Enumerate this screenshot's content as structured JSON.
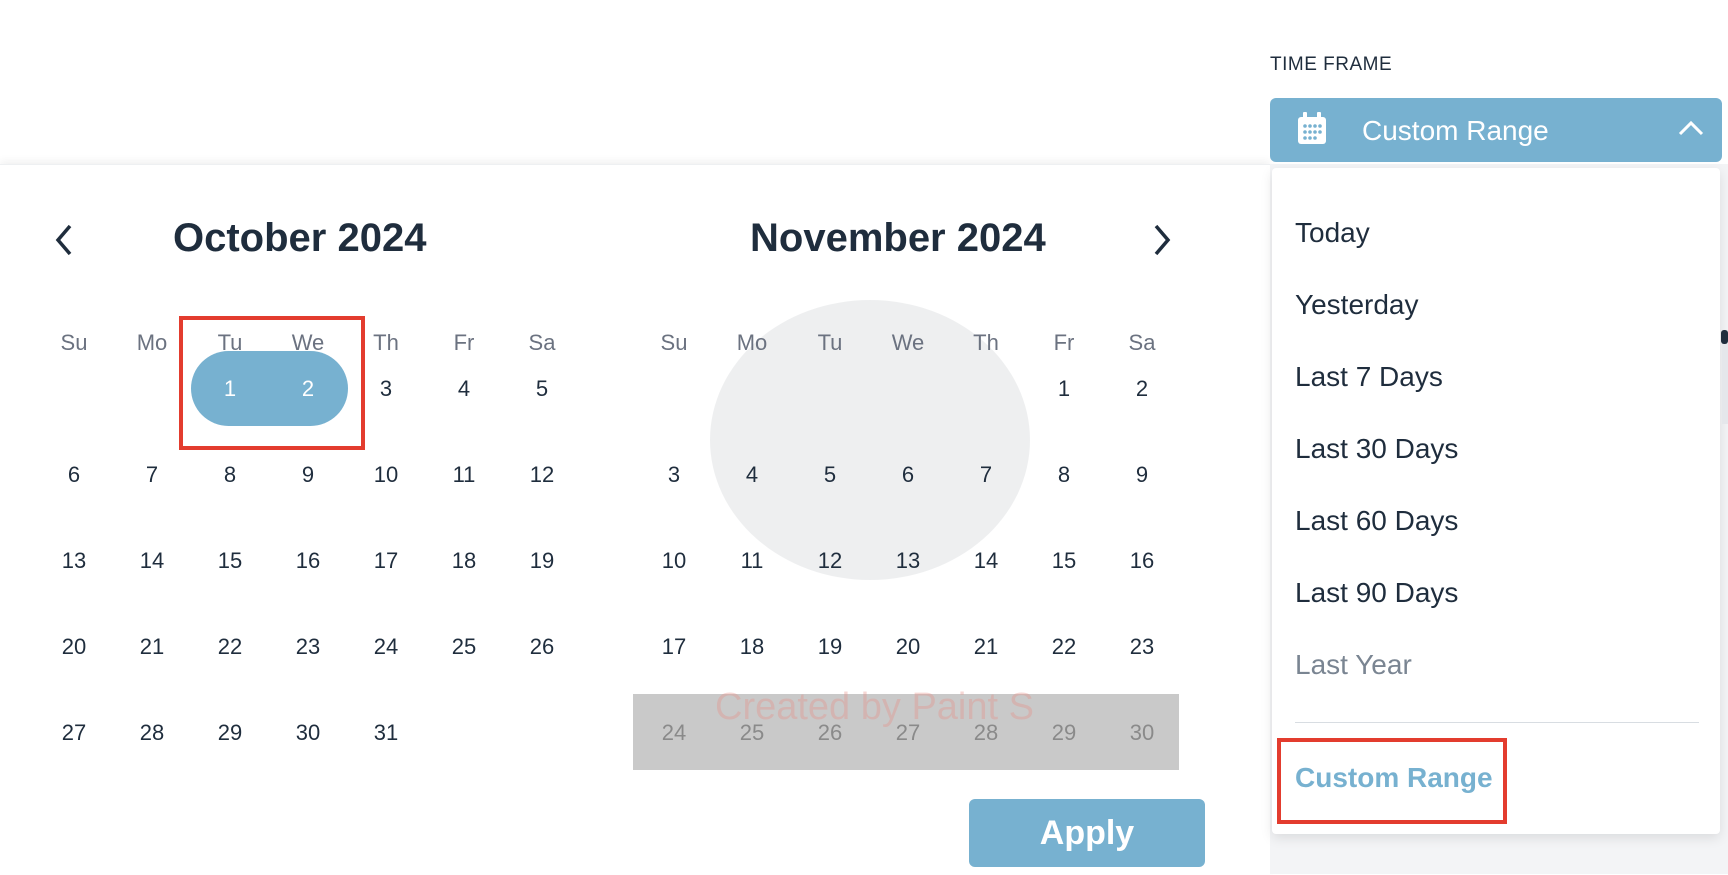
{
  "time_frame": {
    "label": "TIME FRAME",
    "value": "Custom Range"
  },
  "dropdown": {
    "options": [
      "Today",
      "Yesterday",
      "Last 7 Days",
      "Last 30 Days",
      "Last 60 Days",
      "Last 90 Days",
      "Last Year"
    ],
    "custom_range": "Custom Range"
  },
  "calendar": {
    "weekdays": [
      "Su",
      "Mo",
      "Tu",
      "We",
      "Th",
      "Fr",
      "Sa"
    ],
    "months": [
      {
        "title": "October 2024",
        "first_weekday": 2,
        "days": 31,
        "selected": [
          1,
          2
        ]
      },
      {
        "title": "November 2024",
        "first_weekday": 5,
        "days": 30,
        "disabled": [
          24,
          25,
          26,
          27,
          28,
          29,
          30
        ]
      }
    ],
    "apply_label": "Apply"
  },
  "watermark": "Created by Paint S",
  "colors": {
    "accent": "#77b1d0",
    "highlight_box": "#e33c2e",
    "text": "#1f2d3d",
    "disabled_row": "#c9c9c9"
  },
  "icons": {
    "calendar": "calendar-icon",
    "collapse": "chevron-up-icon",
    "prev": "chevron-left-icon",
    "next": "chevron-right-icon"
  }
}
